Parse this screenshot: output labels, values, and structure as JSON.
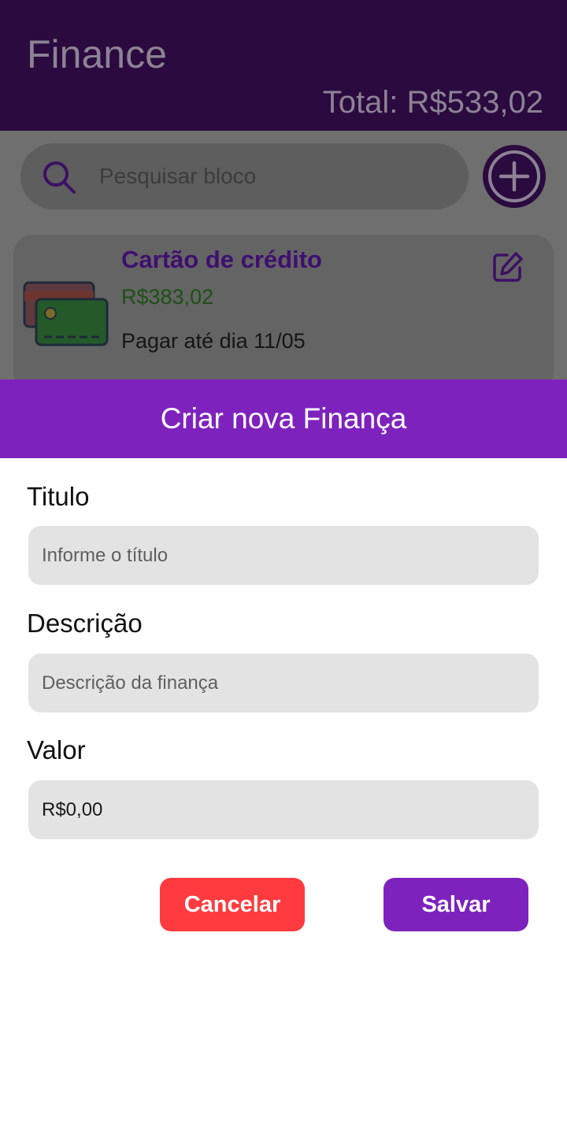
{
  "app": {
    "title": "Finance",
    "total": "Total: R$533,02"
  },
  "search": {
    "placeholder": "Pesquisar bloco"
  },
  "card": {
    "title": "Cartão de crédito",
    "value": "R$383,02",
    "due": "Pagar até dia 11/05"
  },
  "modal": {
    "title": "Criar nova Finança",
    "fields": [
      {
        "label": "Titulo",
        "placeholder": "Informe o título",
        "value": ""
      },
      {
        "label": "Descrição",
        "placeholder": "Descrição da finança",
        "value": ""
      },
      {
        "label": "Valor",
        "placeholder": "",
        "value": "R$0,00"
      }
    ],
    "cancel_label": "Cancelar",
    "save_label": "Salvar"
  },
  "colors": {
    "brand_purple": "#7e22be",
    "header_dark": "#2a0a3f",
    "cancel_red": "#ff3b3f",
    "input_bg": "#e3e3e3"
  },
  "icons": {
    "search": "search-icon",
    "add": "plus-circle-icon",
    "card": "credit-cards-icon",
    "edit": "edit-icon"
  }
}
